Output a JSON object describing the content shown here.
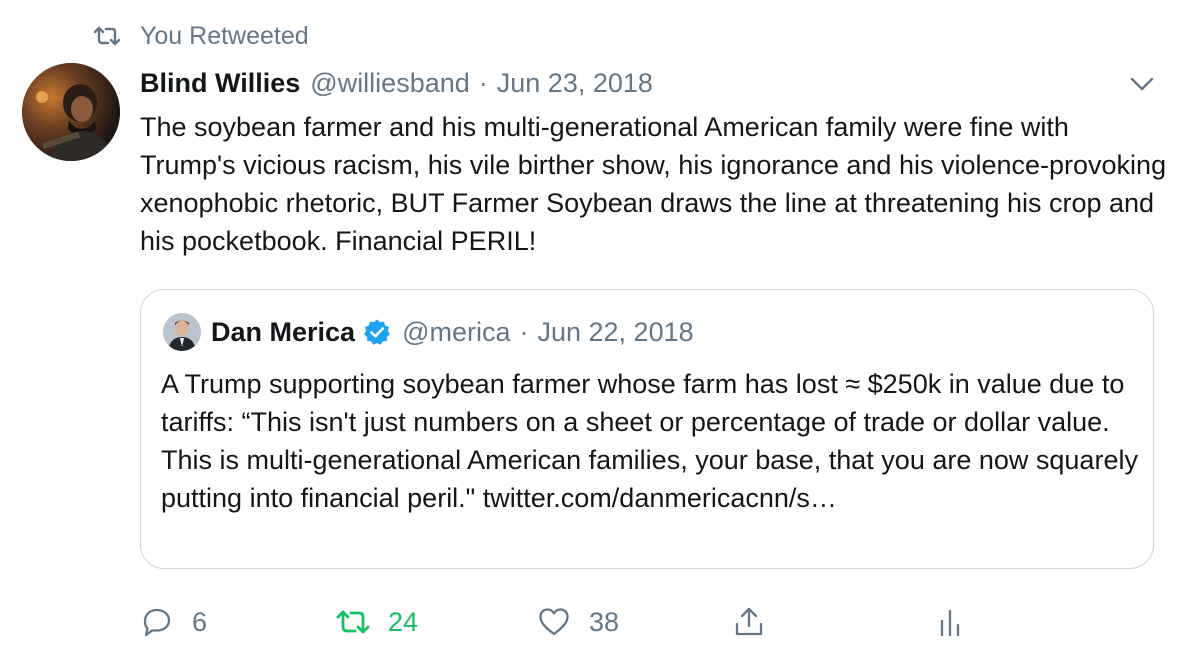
{
  "retweet_banner": {
    "icon": "retweet-icon",
    "label": "You Retweeted"
  },
  "tweet": {
    "author_name": "Blind Willies",
    "handle": "@williesband",
    "separator": "·",
    "date": "Jun 23, 2018",
    "text": "The soybean farmer and his multi-generational American family were fine with Trump's vicious racism, his vile birther show, his ignorance and his violence-provoking xenophobic rhetoric, BUT Farmer Soybean draws the line at threatening his crop and his pocketbook. Financial PERIL!"
  },
  "quoted_tweet": {
    "author_name": "Dan Merica",
    "verified": true,
    "handle": "@merica",
    "separator": "·",
    "date": "Jun 22, 2018",
    "text": "A Trump supporting soybean farmer whose farm has lost ≈ $250k in value due to tariffs: “This isn't just numbers on a sheet or percentage of trade or dollar value. This is multi-generational American families, your base, that you are now squarely putting into financial peril.\" twitter.com/danmericacnn/s…"
  },
  "actions": {
    "reply_count": "6",
    "retweet_count": "24",
    "like_count": "38"
  },
  "colors": {
    "text_primary": "#14171a",
    "text_secondary": "#657786",
    "border": "#ccd6dd",
    "retweet_green": "#17bf63",
    "verified_blue": "#1da1f2"
  }
}
